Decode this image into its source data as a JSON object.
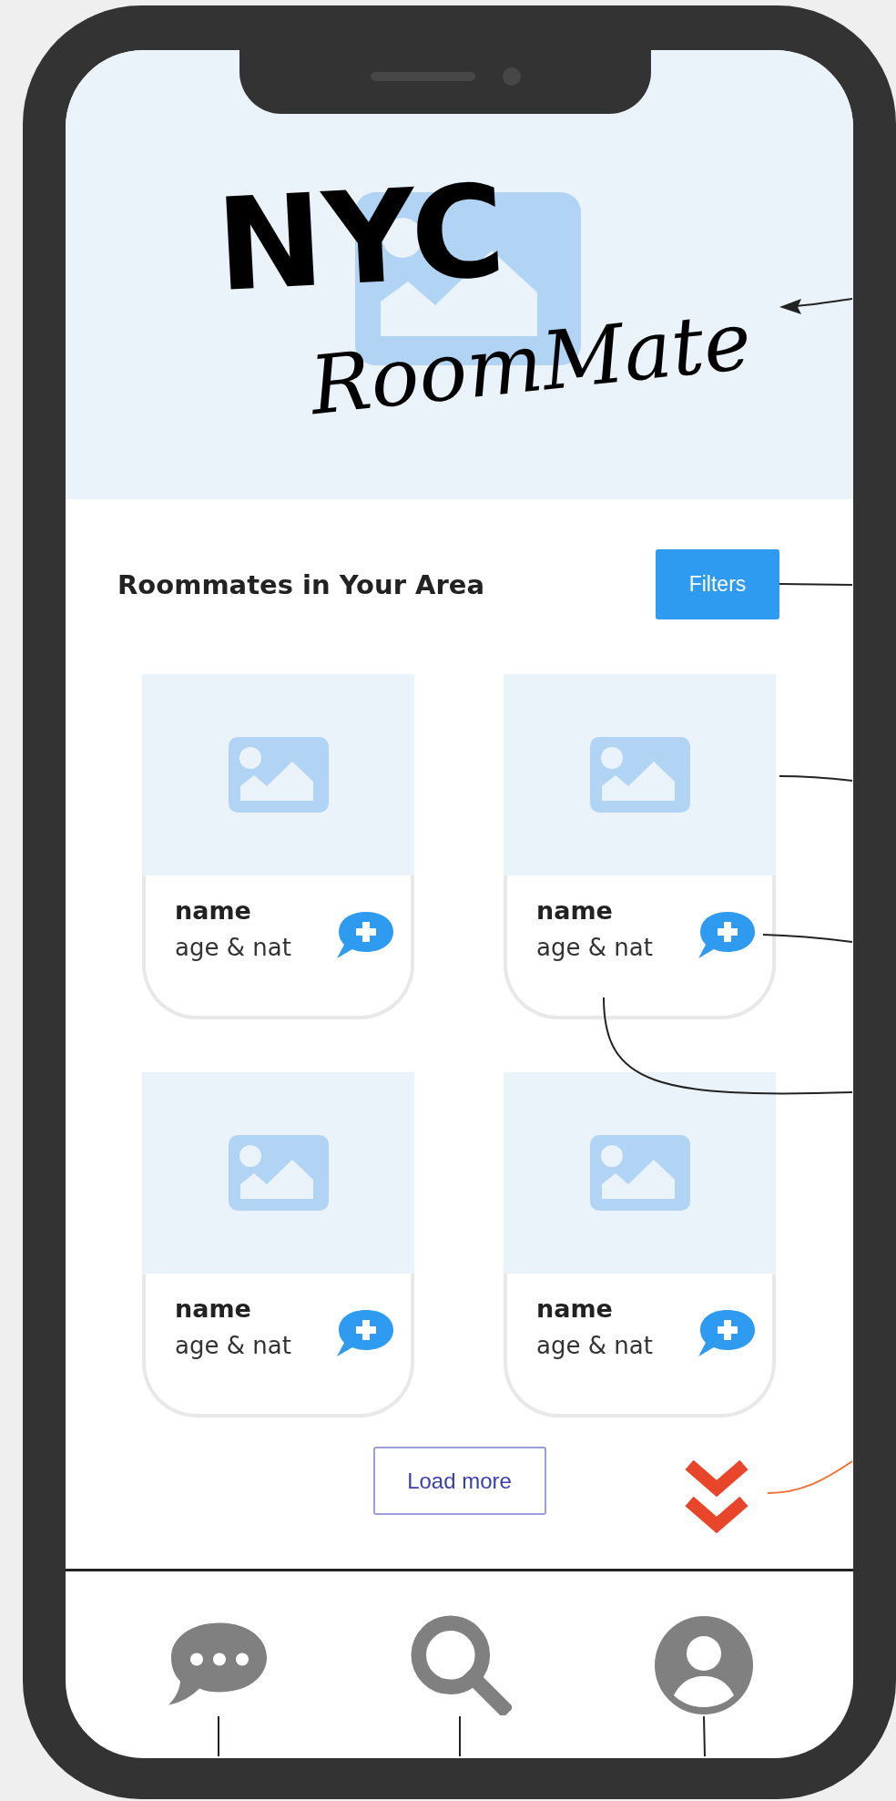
{
  "logo": {
    "line_1": "NYC",
    "line_2": "RoomMate"
  },
  "section": {
    "title": "Roommates in Your Area",
    "filter_button": "Filters"
  },
  "cards": [
    {
      "name": "name",
      "details": "age & nat"
    },
    {
      "name": "name",
      "details": "age & nat"
    },
    {
      "name": "name",
      "details": "age & nat"
    },
    {
      "name": "name",
      "details": "age & nat"
    }
  ],
  "load_more": "Load more"
}
